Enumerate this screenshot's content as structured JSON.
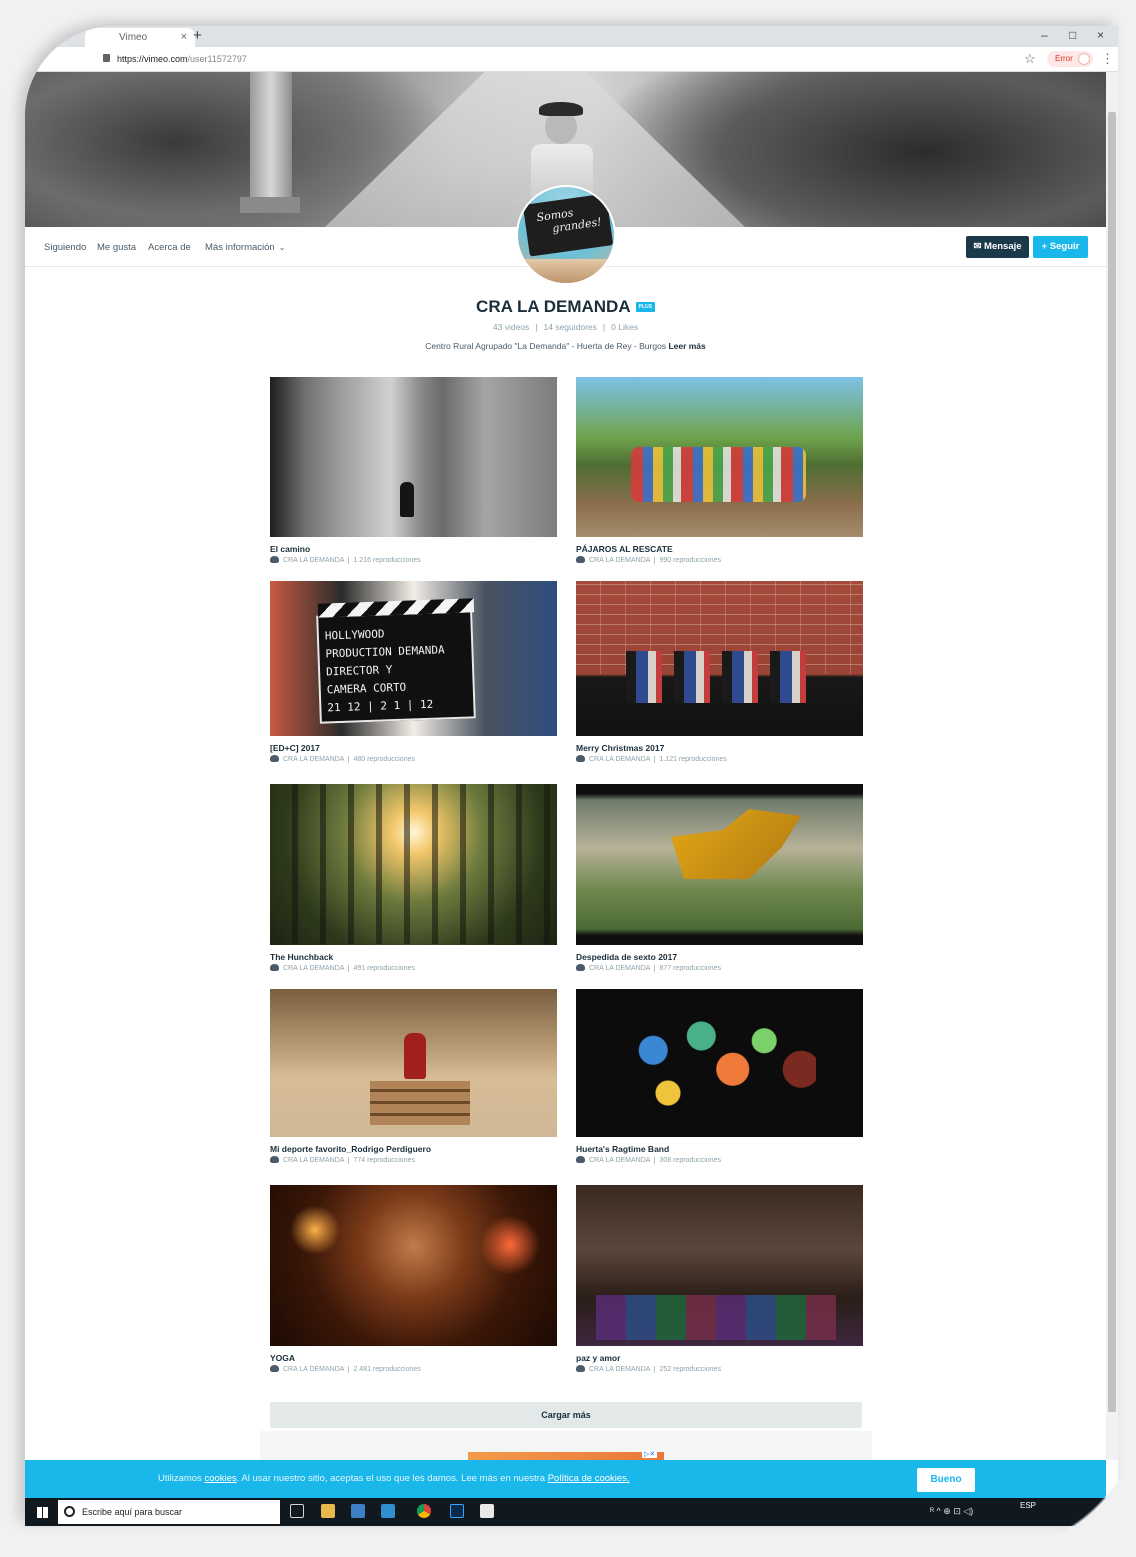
{
  "browser": {
    "tab_title": "Vimeo",
    "tab_close": "×",
    "new_tab": "+",
    "url_host": "https://vimeo.com",
    "url_path": "/user11572797",
    "error_label": "Error",
    "window_minimize": "–",
    "window_maximize": "□",
    "window_close": "×"
  },
  "profile_nav": {
    "items": [
      "Siguiendo",
      "Me gusta",
      "Acerca de",
      "Más información"
    ],
    "message_button": "✉ Mensaje",
    "follow_button": "+ Seguir"
  },
  "avatar": {
    "chalk_line1": "Somos",
    "chalk_line2": "grandes!"
  },
  "profile": {
    "name": "CRA LA DEMANDA",
    "badge": "PLUS",
    "videos": "43 videos",
    "followers": "14 seguidores",
    "likes": "0 Likes",
    "bio": "Centro Rural Agrupado \"La Demanda\" - Huerta de Rey - Burgos",
    "read_more": "Leer más"
  },
  "videos": [
    {
      "title": "El camino",
      "author": "CRA LA DEMANDA",
      "plays": "1.216 reproducciones"
    },
    {
      "title": "PÁJAROS AL RESCATE",
      "author": "CRA LA DEMANDA",
      "plays": "990 reproducciones"
    },
    {
      "title": "[ED+C] 2017",
      "author": "CRA LA DEMANDA",
      "plays": "480 reproducciones"
    },
    {
      "title": "Merry Christmas 2017",
      "author": "CRA LA DEMANDA",
      "plays": "1.121 reproducciones"
    },
    {
      "title": "The Hunchback",
      "author": "CRA LA DEMANDA",
      "plays": "491 reproducciones"
    },
    {
      "title": "Despedida de sexto 2017",
      "author": "CRA LA DEMANDA",
      "plays": "877 reproducciones"
    },
    {
      "title": "Mi deporte favorito_Rodrigo Perdiguero",
      "author": "CRA LA DEMANDA",
      "plays": "774 reproducciones"
    },
    {
      "title": "Huerta's Ragtime Band",
      "author": "CRA LA DEMANDA",
      "plays": "308 reproducciones"
    },
    {
      "title": "YOGA",
      "author": "CRA LA DEMANDA",
      "plays": "2.481 reproducciones"
    },
    {
      "title": "paz y amor",
      "author": "CRA LA DEMANDA",
      "plays": "252 reproducciones"
    }
  ],
  "clapper": {
    "line1": "HOLLYWOOD",
    "line2": "PRODUCTION  DEMANDA",
    "line3": "DIRECTOR   Y",
    "line4": "CAMERA   CORTO",
    "line5": "21 12 | 2 1 | 12"
  },
  "load_more": "Cargar más",
  "cookie_banner": {
    "text_before": "Utilizamos ",
    "link_cookies": "cookies",
    "text_middle": ". Al usar nuestro sitio, aceptas el uso que les damos. Lee más en nuestra ",
    "link_policy": "Política de cookies.",
    "ok_button": "Bueno"
  },
  "taskbar": {
    "search_placeholder": "Escribe aquí para buscar",
    "tray_text": "ᴿ ^ ⊕ ⊡ ◁)",
    "lang": "ESP"
  },
  "colors": {
    "accent": "#1ab7ea",
    "dark_button": "#1a3a4a",
    "title_text": "#1a2e3b",
    "meta_text": "#8fa2ad"
  }
}
